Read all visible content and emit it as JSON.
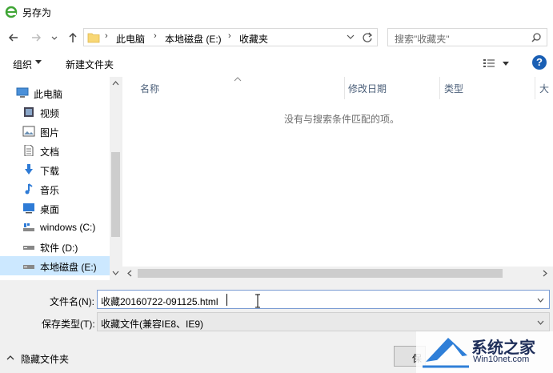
{
  "window": {
    "title": "另存为"
  },
  "address": {
    "crumbs": [
      "此电脑",
      "本地磁盘 (E:)",
      "收藏夹"
    ]
  },
  "search": {
    "placeholder": "搜索\"收藏夹\""
  },
  "toolbar": {
    "organize_label": "组织",
    "new_folder_label": "新建文件夹"
  },
  "nav_pane": {
    "items": [
      {
        "label": "此电脑",
        "icon": "computer-icon"
      },
      {
        "label": "视频",
        "icon": "video-icon"
      },
      {
        "label": "图片",
        "icon": "picture-icon"
      },
      {
        "label": "文档",
        "icon": "document-icon"
      },
      {
        "label": "下载",
        "icon": "download-icon"
      },
      {
        "label": "音乐",
        "icon": "music-icon"
      },
      {
        "label": "桌面",
        "icon": "desktop-icon"
      },
      {
        "label": "windows (C:)",
        "icon": "drive-icon"
      },
      {
        "label": "软件 (D:)",
        "icon": "drive-icon"
      },
      {
        "label": "本地磁盘 (E:)",
        "icon": "drive-icon",
        "selected": true
      }
    ]
  },
  "file_list": {
    "columns": [
      "名称",
      "修改日期",
      "类型",
      "大"
    ],
    "empty_message": "没有与搜索条件匹配的项。"
  },
  "form": {
    "filename_label": "文件名(N):",
    "filename_value": "收藏20160722-091125.html",
    "filetype_label": "保存类型(T):",
    "filetype_value": "收藏文件(兼容IE8、IE9)"
  },
  "footer": {
    "hide_folders_label": "隐藏文件夹",
    "save_label": "保"
  },
  "watermark": {
    "title": "系统之家",
    "subtitle": "Win10net.com"
  },
  "colors": {
    "selected": "#cce8ff",
    "accent": "#1a5fb4",
    "chrome": "#f0f0f0"
  }
}
